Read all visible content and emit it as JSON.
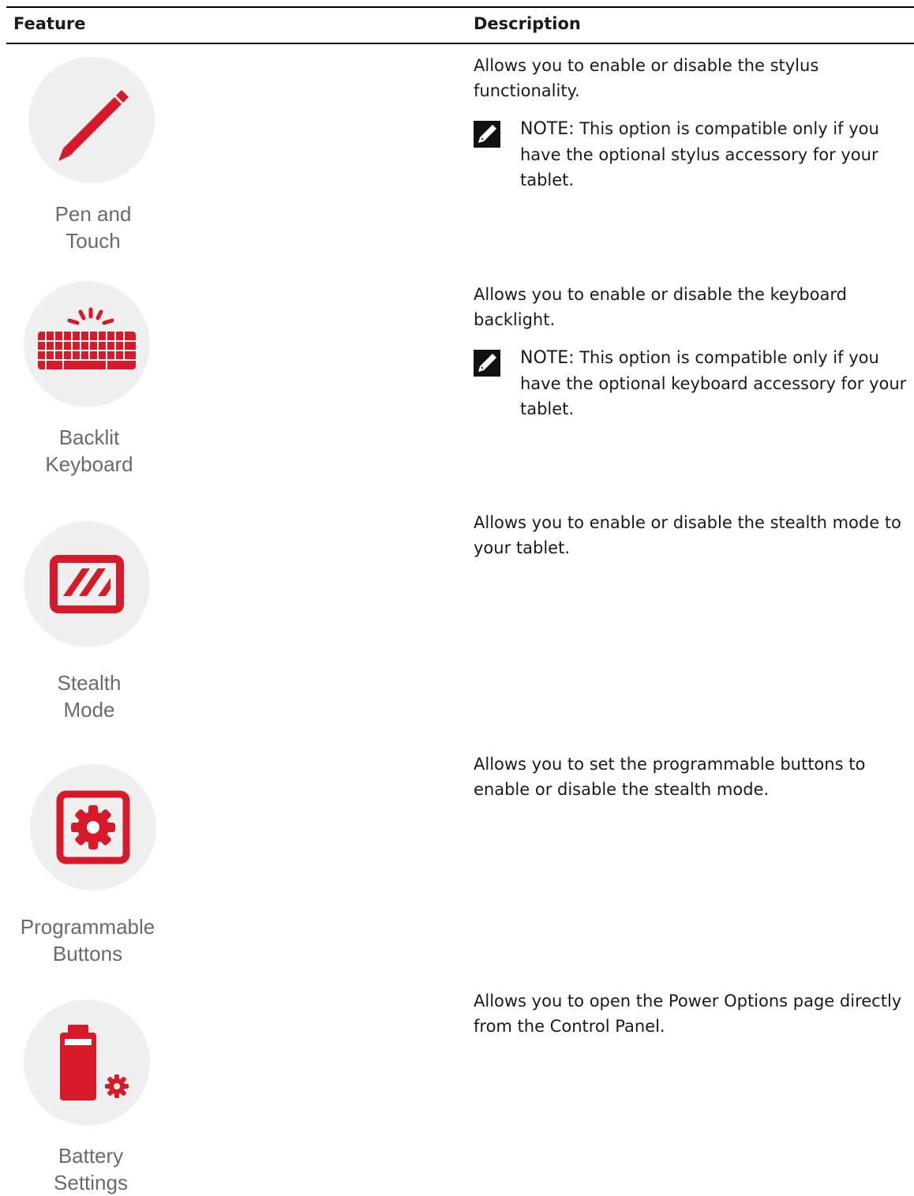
{
  "table": {
    "headers": {
      "feature": "Feature",
      "description": "Description"
    },
    "rows": [
      {
        "icon": "pen-icon",
        "label_line1": "Pen and",
        "label_line2": "Touch",
        "description": "Allows you to enable or disable the stylus functionality.",
        "note_label": "NOTE:",
        "note_text": " This option is compatible only if you have the optional stylus accessory for your tablet."
      },
      {
        "icon": "keyboard-icon",
        "label_line1": "Backlit",
        "label_line2": "Keyboard",
        "description": "Allows you to enable or disable the keyboard backlight.",
        "note_label": "NOTE:",
        "note_text": " This option is compatible only if you have the optional keyboard accessory for your tablet."
      },
      {
        "icon": "stealth-mode-icon",
        "label_line1": "Stealth",
        "label_line2": "Mode",
        "description": "Allows you to enable or disable the stealth mode to your tablet."
      },
      {
        "icon": "gear-button-icon",
        "label_line1": "Programmable",
        "label_line2": "Buttons",
        "description": "Allows you to set the programmable buttons to enable or disable the stealth mode."
      },
      {
        "icon": "battery-settings-icon",
        "label_line1": "Battery",
        "label_line2": "Settings",
        "description": "Allows you to open the Power Options page directly from the Control Panel."
      }
    ]
  },
  "colors": {
    "accent": "#d71a2a",
    "icon_background": "#f0f0f0",
    "label_gray": "#6a6a6a"
  }
}
